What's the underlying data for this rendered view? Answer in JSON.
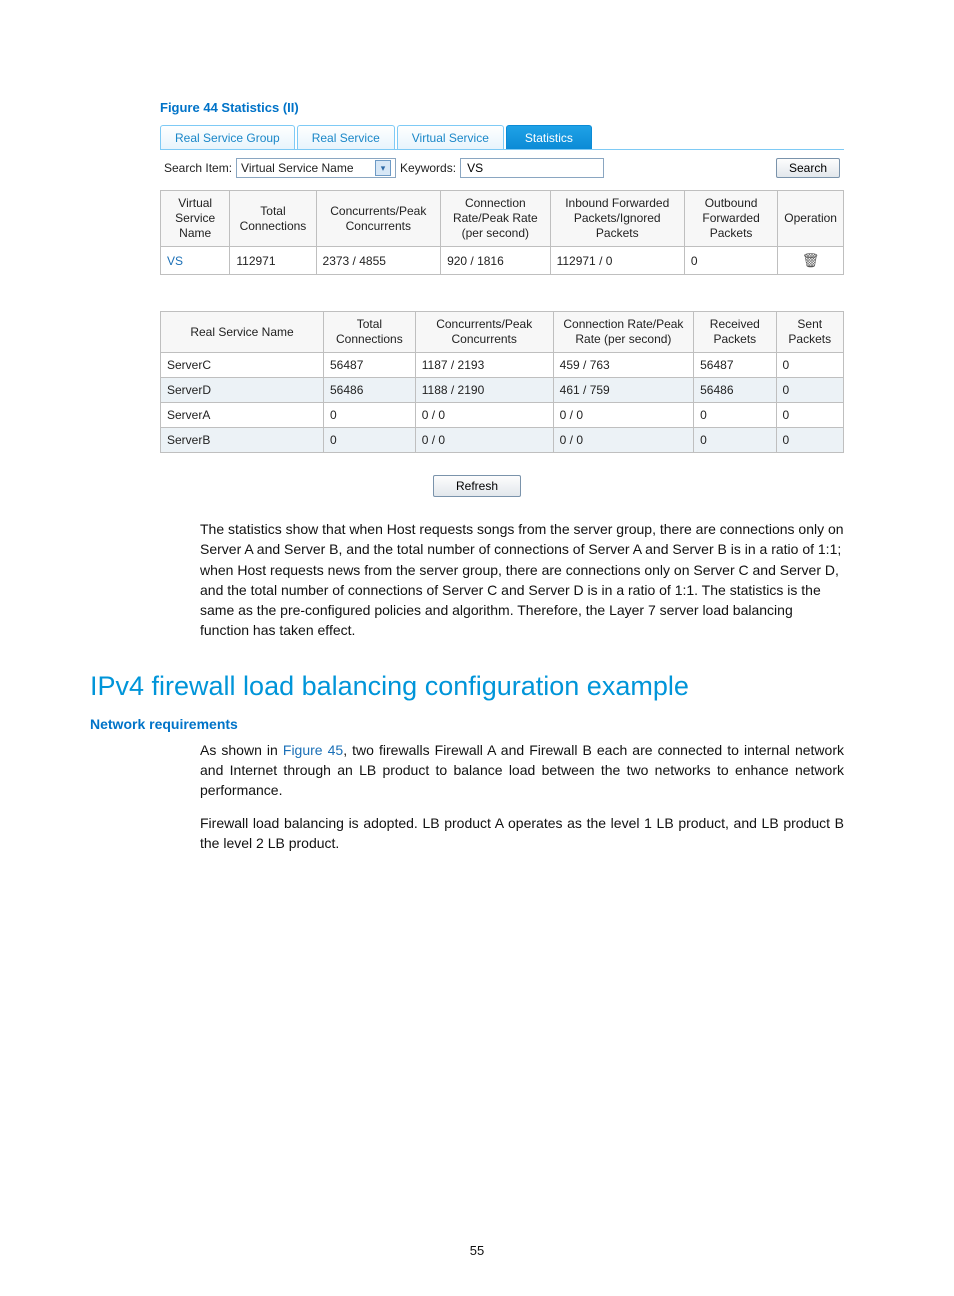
{
  "figure_caption": "Figure 44 Statistics (II)",
  "tabs": {
    "items": [
      {
        "label": "Real Service Group",
        "active": false
      },
      {
        "label": "Real Service",
        "active": false
      },
      {
        "label": "Virtual Service",
        "active": false
      },
      {
        "label": "Statistics",
        "active": true
      }
    ]
  },
  "search": {
    "label_item": "Search Item:",
    "select_value": "Virtual Service Name",
    "label_keywords": "Keywords:",
    "keywords_value": "VS",
    "button_label": "Search"
  },
  "table1": {
    "headers": [
      "Virtual Service Name",
      "Total Connections",
      "Concurrents/Peak Concurrents",
      "Connection Rate/Peak Rate (per second)",
      "Inbound Forwarded Packets/Ignored Packets",
      "Outbound Forwarded Packets",
      "Operation"
    ],
    "rows": [
      {
        "name": "VS",
        "total": "112971",
        "concur": "2373 / 4855",
        "rate": "920 / 1816",
        "inbound": "112971 / 0",
        "outbound": "0"
      }
    ]
  },
  "table2": {
    "headers": [
      "Real Service Name",
      "Total Connections",
      "Concurrents/Peak Concurrents",
      "Connection Rate/Peak Rate (per second)",
      "Received Packets",
      "Sent Packets"
    ],
    "rows": [
      {
        "name": "ServerC",
        "total": "56487",
        "concur": "1187 / 2193",
        "rate": "459 / 763",
        "recv": "56487",
        "sent": "0"
      },
      {
        "name": "ServerD",
        "total": "56486",
        "concur": "1188 / 2190",
        "rate": "461 / 759",
        "recv": "56486",
        "sent": "0"
      },
      {
        "name": "ServerA",
        "total": "0",
        "concur": "0 / 0",
        "rate": "0 / 0",
        "recv": "0",
        "sent": "0"
      },
      {
        "name": "ServerB",
        "total": "0",
        "concur": "0 / 0",
        "rate": "0 / 0",
        "recv": "0",
        "sent": "0"
      }
    ]
  },
  "refresh_label": "Refresh",
  "paragraph1": "The statistics show that when Host requests songs from the server group, there are connections only on Server A and Server B, and the total number of connections of Server A and Server B is in a ratio of 1:1; when Host requests news from the server group, there are connections only on Server C and Server D, and the total number of connections of Server C and Server D is in a ratio of 1:1. The statistics is the same as the pre-configured policies and algorithm. Therefore, the Layer 7 server load balancing function has taken effect.",
  "heading_main": "IPv4 firewall load balancing configuration example",
  "heading_sub": "Network requirements",
  "para2_pre": "As shown in ",
  "para2_link": "Figure 45",
  "para2_post": ", two firewalls Firewall A and Firewall B each are connected to internal network and Internet through an LB product to balance load between the two networks to enhance network performance.",
  "para3": "Firewall load balancing is adopted. LB product A operates as the level 1 LB product, and LB product B the level 2 LB product.",
  "page_number": "55"
}
